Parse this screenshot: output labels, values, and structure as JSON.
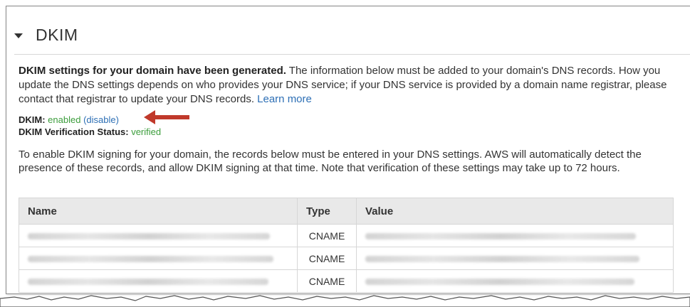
{
  "section": {
    "title": "DKIM"
  },
  "intro": {
    "bold": "DKIM settings for your domain have been generated.",
    "text": " The information below must be added to your domain's DNS records. How you update the DNS settings depends on who provides your DNS service; if your DNS service is provided by a domain name registrar, please contact that registrar to update your DNS records. ",
    "link": "Learn more"
  },
  "dkim": {
    "label": "DKIM:",
    "value": "enabled",
    "action_open": "(",
    "action": "disable",
    "action_close": ")",
    "verification_label": "DKIM Verification Status:",
    "verification_value": "verified"
  },
  "instructions": "To enable DKIM signing for your domain, the records below must be entered in your DNS settings. AWS will automatically detect the presence of these records, and allow DKIM signing at that time. Note that verification of these settings may take up to 72 hours.",
  "table": {
    "columns": [
      "Name",
      "Type",
      "Value"
    ],
    "rows": [
      {
        "type": "CNAME"
      },
      {
        "type": "CNAME"
      },
      {
        "type": "CNAME"
      }
    ]
  },
  "colors": {
    "accent_link": "#2d6fb5",
    "status_green": "#3c9d3c",
    "annotation_arrow": "#c0392b"
  }
}
